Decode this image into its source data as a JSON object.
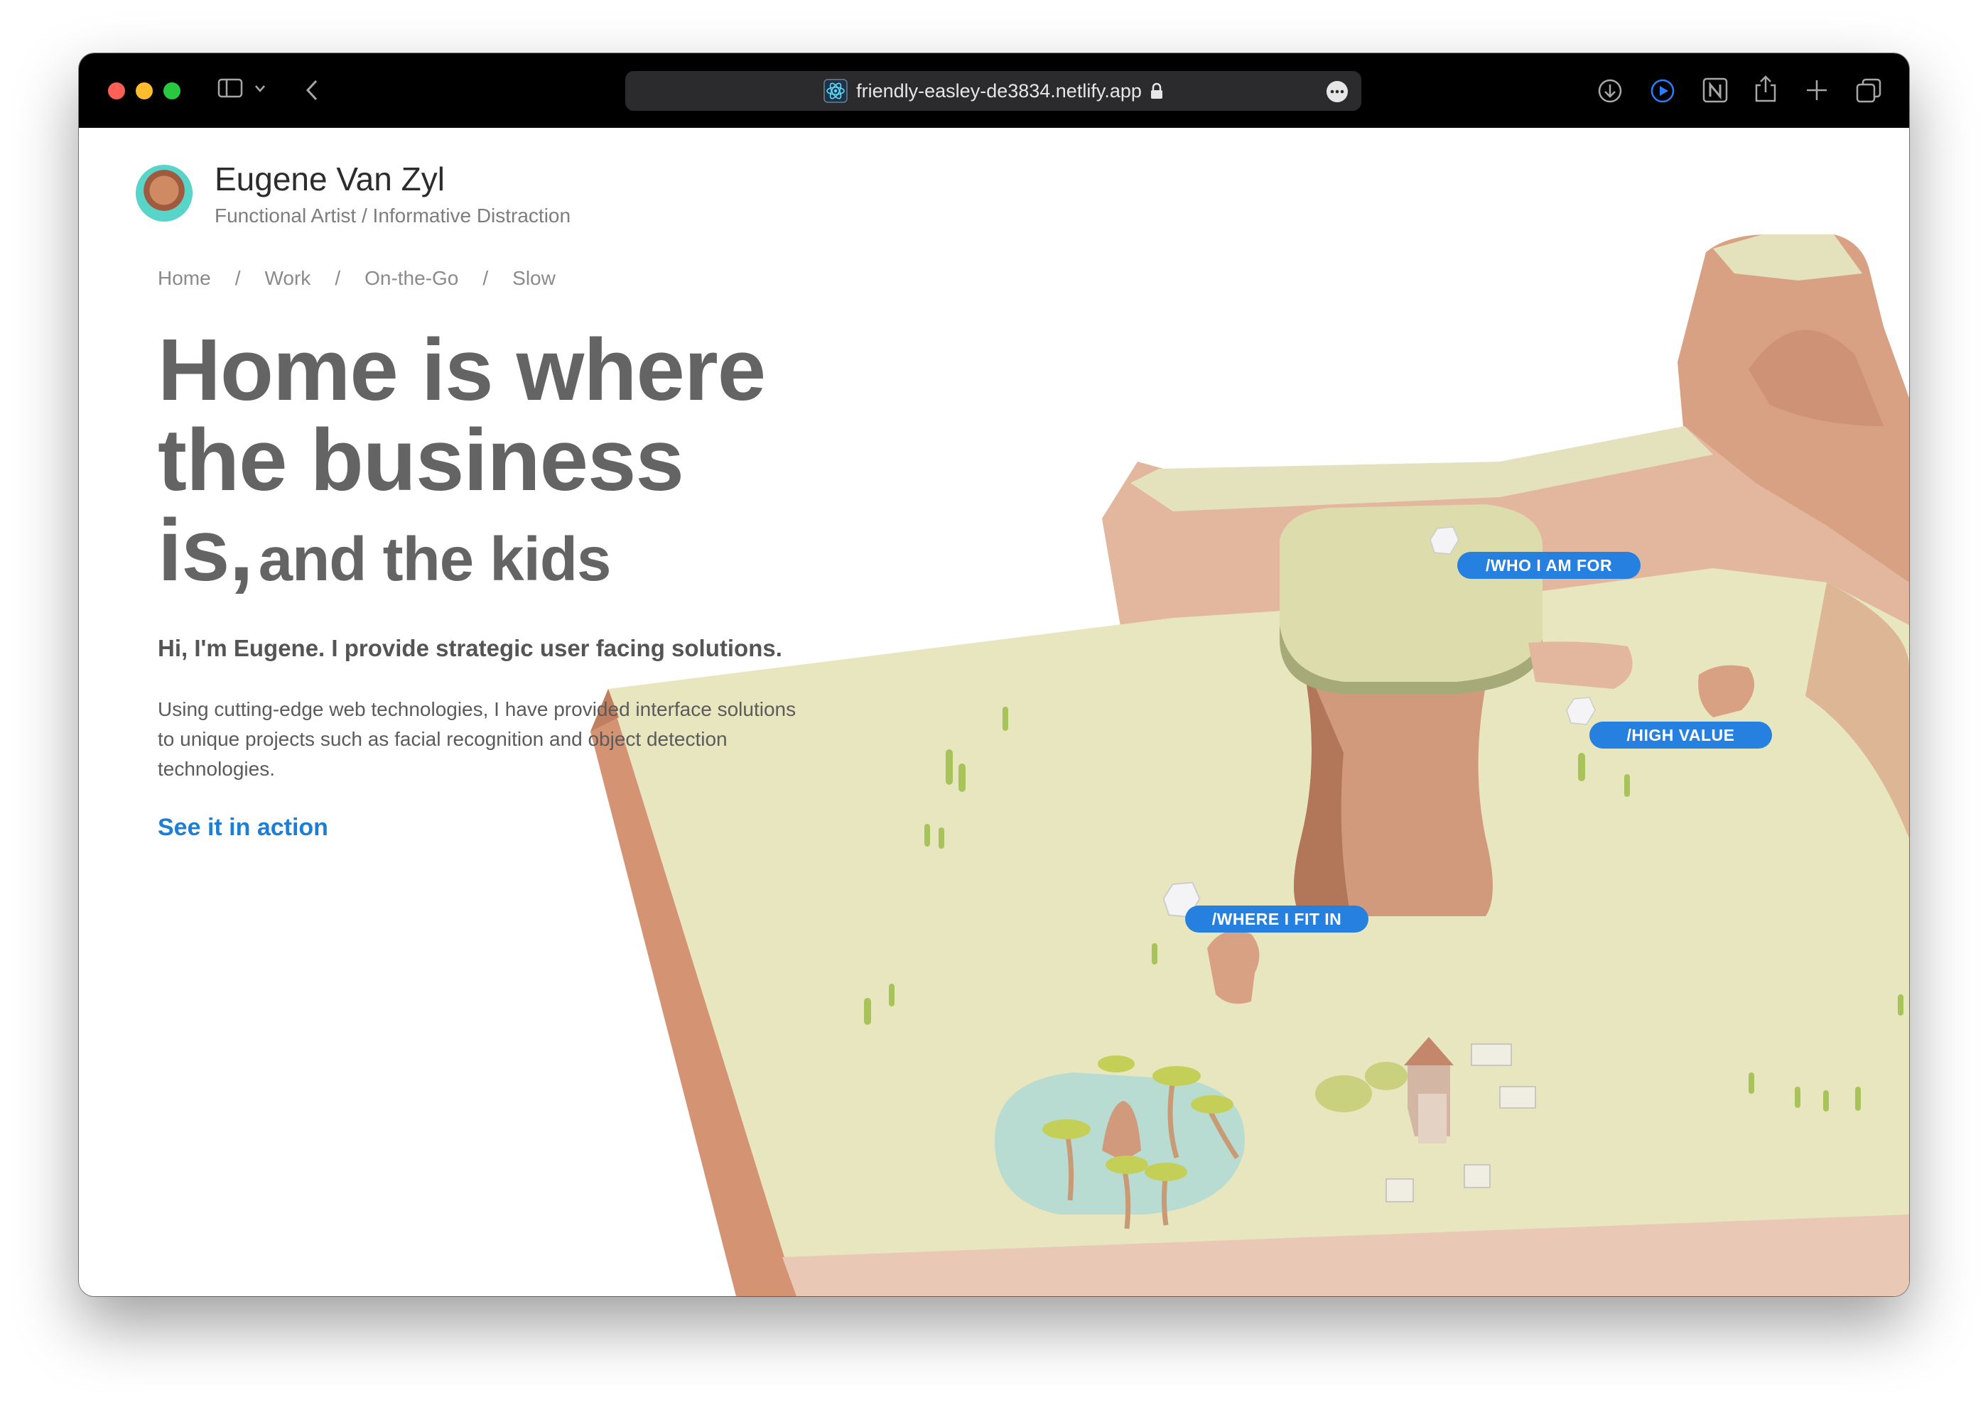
{
  "browser": {
    "url": "friendly-easley-de3834.netlify.app"
  },
  "site": {
    "name": "Eugene Van Zyl",
    "tagline": "Functional Artist / Informative Distraction"
  },
  "nav": {
    "items": [
      "Home",
      "Work",
      "On-the-Go",
      "Slow"
    ],
    "separator": "/"
  },
  "hero": {
    "line1": "Home is where",
    "line2": "the business",
    "line3_big": "is,",
    "line3_small": "and the kids"
  },
  "intro": "Hi, I'm Eugene. I provide strategic user facing solutions.",
  "description": "Using cutting-edge web technologies, I have provided interface solutions to unique projects such as facial recognition and object detection technologies.",
  "cta": "See it in action",
  "scene_labels": {
    "who": "/WHO I AM FOR",
    "value": "/HIGH VALUE",
    "where": "/WHERE I FIT IN"
  },
  "colors": {
    "accent": "#1e7ed6",
    "pill": "#2580df",
    "sand": "#e7e6bf",
    "rock": "#d59a7a"
  }
}
